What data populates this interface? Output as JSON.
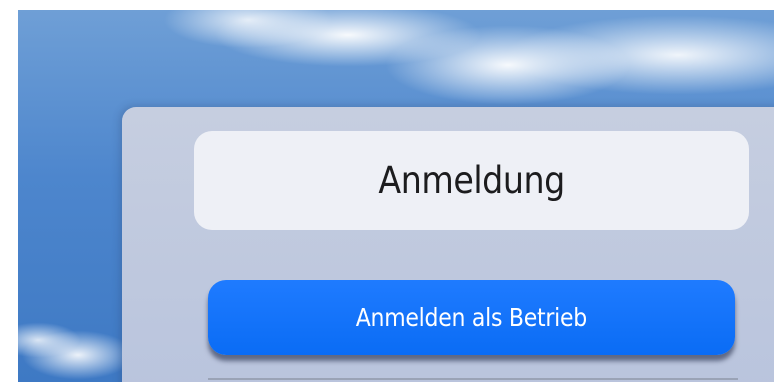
{
  "login_panel": {
    "title": "Anmeldung",
    "login_company_button": "Anmelden als Betrieb"
  },
  "colors": {
    "button_blue": "#1f7bff",
    "panel_bg": "#c1cadf",
    "title_box_bg": "#eef0f6"
  }
}
